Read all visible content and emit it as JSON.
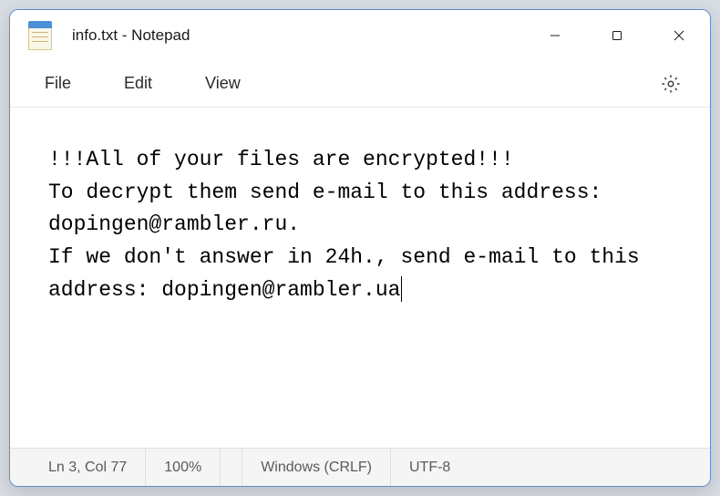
{
  "window": {
    "title": "info.txt - Notepad"
  },
  "menu": {
    "file": "File",
    "edit": "Edit",
    "view": "View"
  },
  "editor": {
    "content": "!!!All of your files are encrypted!!!\nTo decrypt them send e-mail to this address: dopingen@rambler.ru.\nIf we don't answer in 24h., send e-mail to this address: dopingen@rambler.ua"
  },
  "statusbar": {
    "position": "Ln 3, Col 77",
    "zoom": "100%",
    "line_ending": "Windows (CRLF)",
    "encoding": "UTF-8"
  }
}
